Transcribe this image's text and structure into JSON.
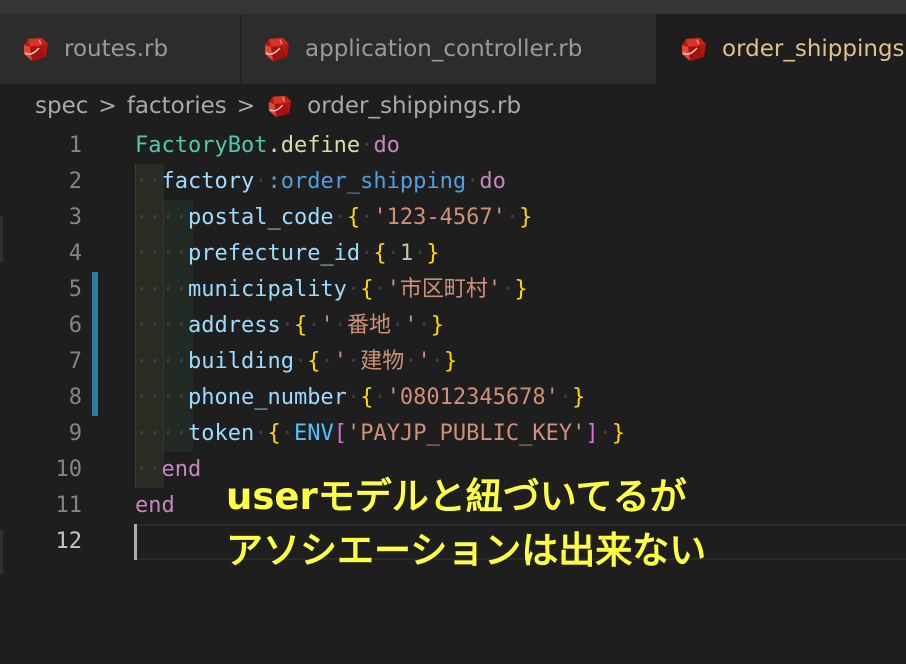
{
  "tabs": [
    {
      "label": "routes.rb",
      "icon": "ruby-icon",
      "active": false
    },
    {
      "label": "application_controller.rb",
      "icon": "ruby-icon",
      "active": false
    },
    {
      "label": "order_shippings.rb",
      "icon": "ruby-icon",
      "active": true
    }
  ],
  "breadcrumb": {
    "items": [
      "spec",
      "factories",
      "order_shippings.rb"
    ],
    "separator": ">"
  },
  "editor": {
    "active_line": 12,
    "modified_lines": [
      5,
      6,
      7,
      8
    ],
    "line_numbers": [
      "1",
      "2",
      "3",
      "4",
      "5",
      "6",
      "7",
      "8",
      "9",
      "10",
      "11",
      "12"
    ],
    "lines": [
      [
        {
          "t": "FactoryBot",
          "c": "k-class"
        },
        {
          "t": ".",
          "c": "k-plain"
        },
        {
          "t": "define",
          "c": "k-method"
        },
        {
          "t": "·",
          "c": "ws"
        },
        {
          "t": "do",
          "c": "k-kw"
        }
      ],
      [
        {
          "t": "··",
          "c": "ws"
        },
        {
          "t": "factory",
          "c": "k-attr"
        },
        {
          "t": "·",
          "c": "ws"
        },
        {
          "t": ":order_shipping",
          "c": "k-sym"
        },
        {
          "t": "·",
          "c": "ws"
        },
        {
          "t": "do",
          "c": "k-kw"
        }
      ],
      [
        {
          "t": "····",
          "c": "ws"
        },
        {
          "t": "postal_code",
          "c": "k-attr"
        },
        {
          "t": "·",
          "c": "ws"
        },
        {
          "t": "{",
          "c": "k-brace"
        },
        {
          "t": "·",
          "c": "ws"
        },
        {
          "t": "'123-4567'",
          "c": "k-str"
        },
        {
          "t": "·",
          "c": "ws"
        },
        {
          "t": "}",
          "c": "k-brace"
        }
      ],
      [
        {
          "t": "····",
          "c": "ws"
        },
        {
          "t": "prefecture_id",
          "c": "k-attr"
        },
        {
          "t": "·",
          "c": "ws"
        },
        {
          "t": "{",
          "c": "k-brace"
        },
        {
          "t": "·",
          "c": "ws"
        },
        {
          "t": "1",
          "c": "k-num"
        },
        {
          "t": "·",
          "c": "ws"
        },
        {
          "t": "}",
          "c": "k-brace"
        }
      ],
      [
        {
          "t": "····",
          "c": "ws"
        },
        {
          "t": "municipality",
          "c": "k-attr"
        },
        {
          "t": "·",
          "c": "ws"
        },
        {
          "t": "{",
          "c": "k-brace"
        },
        {
          "t": "·",
          "c": "ws"
        },
        {
          "t": "'市区町村'",
          "c": "k-str"
        },
        {
          "t": "·",
          "c": "ws"
        },
        {
          "t": "}",
          "c": "k-brace"
        }
      ],
      [
        {
          "t": "····",
          "c": "ws"
        },
        {
          "t": "address",
          "c": "k-attr"
        },
        {
          "t": "·",
          "c": "ws"
        },
        {
          "t": "{",
          "c": "k-brace"
        },
        {
          "t": "·",
          "c": "ws"
        },
        {
          "t": "'",
          "c": "k-str"
        },
        {
          "t": "·",
          "c": "ws"
        },
        {
          "t": "番地",
          "c": "k-str"
        },
        {
          "t": "·",
          "c": "ws"
        },
        {
          "t": "'",
          "c": "k-str"
        },
        {
          "t": "·",
          "c": "ws"
        },
        {
          "t": "}",
          "c": "k-brace"
        }
      ],
      [
        {
          "t": "····",
          "c": "ws"
        },
        {
          "t": "building",
          "c": "k-attr"
        },
        {
          "t": "·",
          "c": "ws"
        },
        {
          "t": "{",
          "c": "k-brace"
        },
        {
          "t": "·",
          "c": "ws"
        },
        {
          "t": "'",
          "c": "k-str"
        },
        {
          "t": "·",
          "c": "ws"
        },
        {
          "t": "建物",
          "c": "k-str"
        },
        {
          "t": "·",
          "c": "ws"
        },
        {
          "t": "'",
          "c": "k-str"
        },
        {
          "t": "·",
          "c": "ws"
        },
        {
          "t": "}",
          "c": "k-brace"
        }
      ],
      [
        {
          "t": "····",
          "c": "ws"
        },
        {
          "t": "phone_number",
          "c": "k-attr"
        },
        {
          "t": "·",
          "c": "ws"
        },
        {
          "t": "{",
          "c": "k-brace"
        },
        {
          "t": "·",
          "c": "ws"
        },
        {
          "t": "'08012345678'",
          "c": "k-str"
        },
        {
          "t": "·",
          "c": "ws"
        },
        {
          "t": "}",
          "c": "k-brace"
        }
      ],
      [
        {
          "t": "····",
          "c": "ws"
        },
        {
          "t": "token",
          "c": "k-attr"
        },
        {
          "t": "·",
          "c": "ws"
        },
        {
          "t": "{",
          "c": "k-brace"
        },
        {
          "t": "·",
          "c": "ws"
        },
        {
          "t": "ENV",
          "c": "k-const"
        },
        {
          "t": "[",
          "c": "k-bracket"
        },
        {
          "t": "'PAYJP_PUBLIC_KEY'",
          "c": "k-str"
        },
        {
          "t": "]",
          "c": "k-bracket"
        },
        {
          "t": "·",
          "c": "ws"
        },
        {
          "t": "}",
          "c": "k-brace"
        }
      ],
      [
        {
          "t": "··",
          "c": "ws"
        },
        {
          "t": "end",
          "c": "k-kw"
        }
      ],
      [
        {
          "t": "end",
          "c": "k-kw"
        }
      ],
      []
    ]
  },
  "annotation": {
    "line1": "userモデルと紐づいてるが",
    "line2": "アソシエーションは出来ない",
    "color": "#ffff44"
  },
  "colors": {
    "editor_bg": "#1e1e1e",
    "tab_active_text": "#e2c08d",
    "modified_bar": "#2f7ba3"
  }
}
